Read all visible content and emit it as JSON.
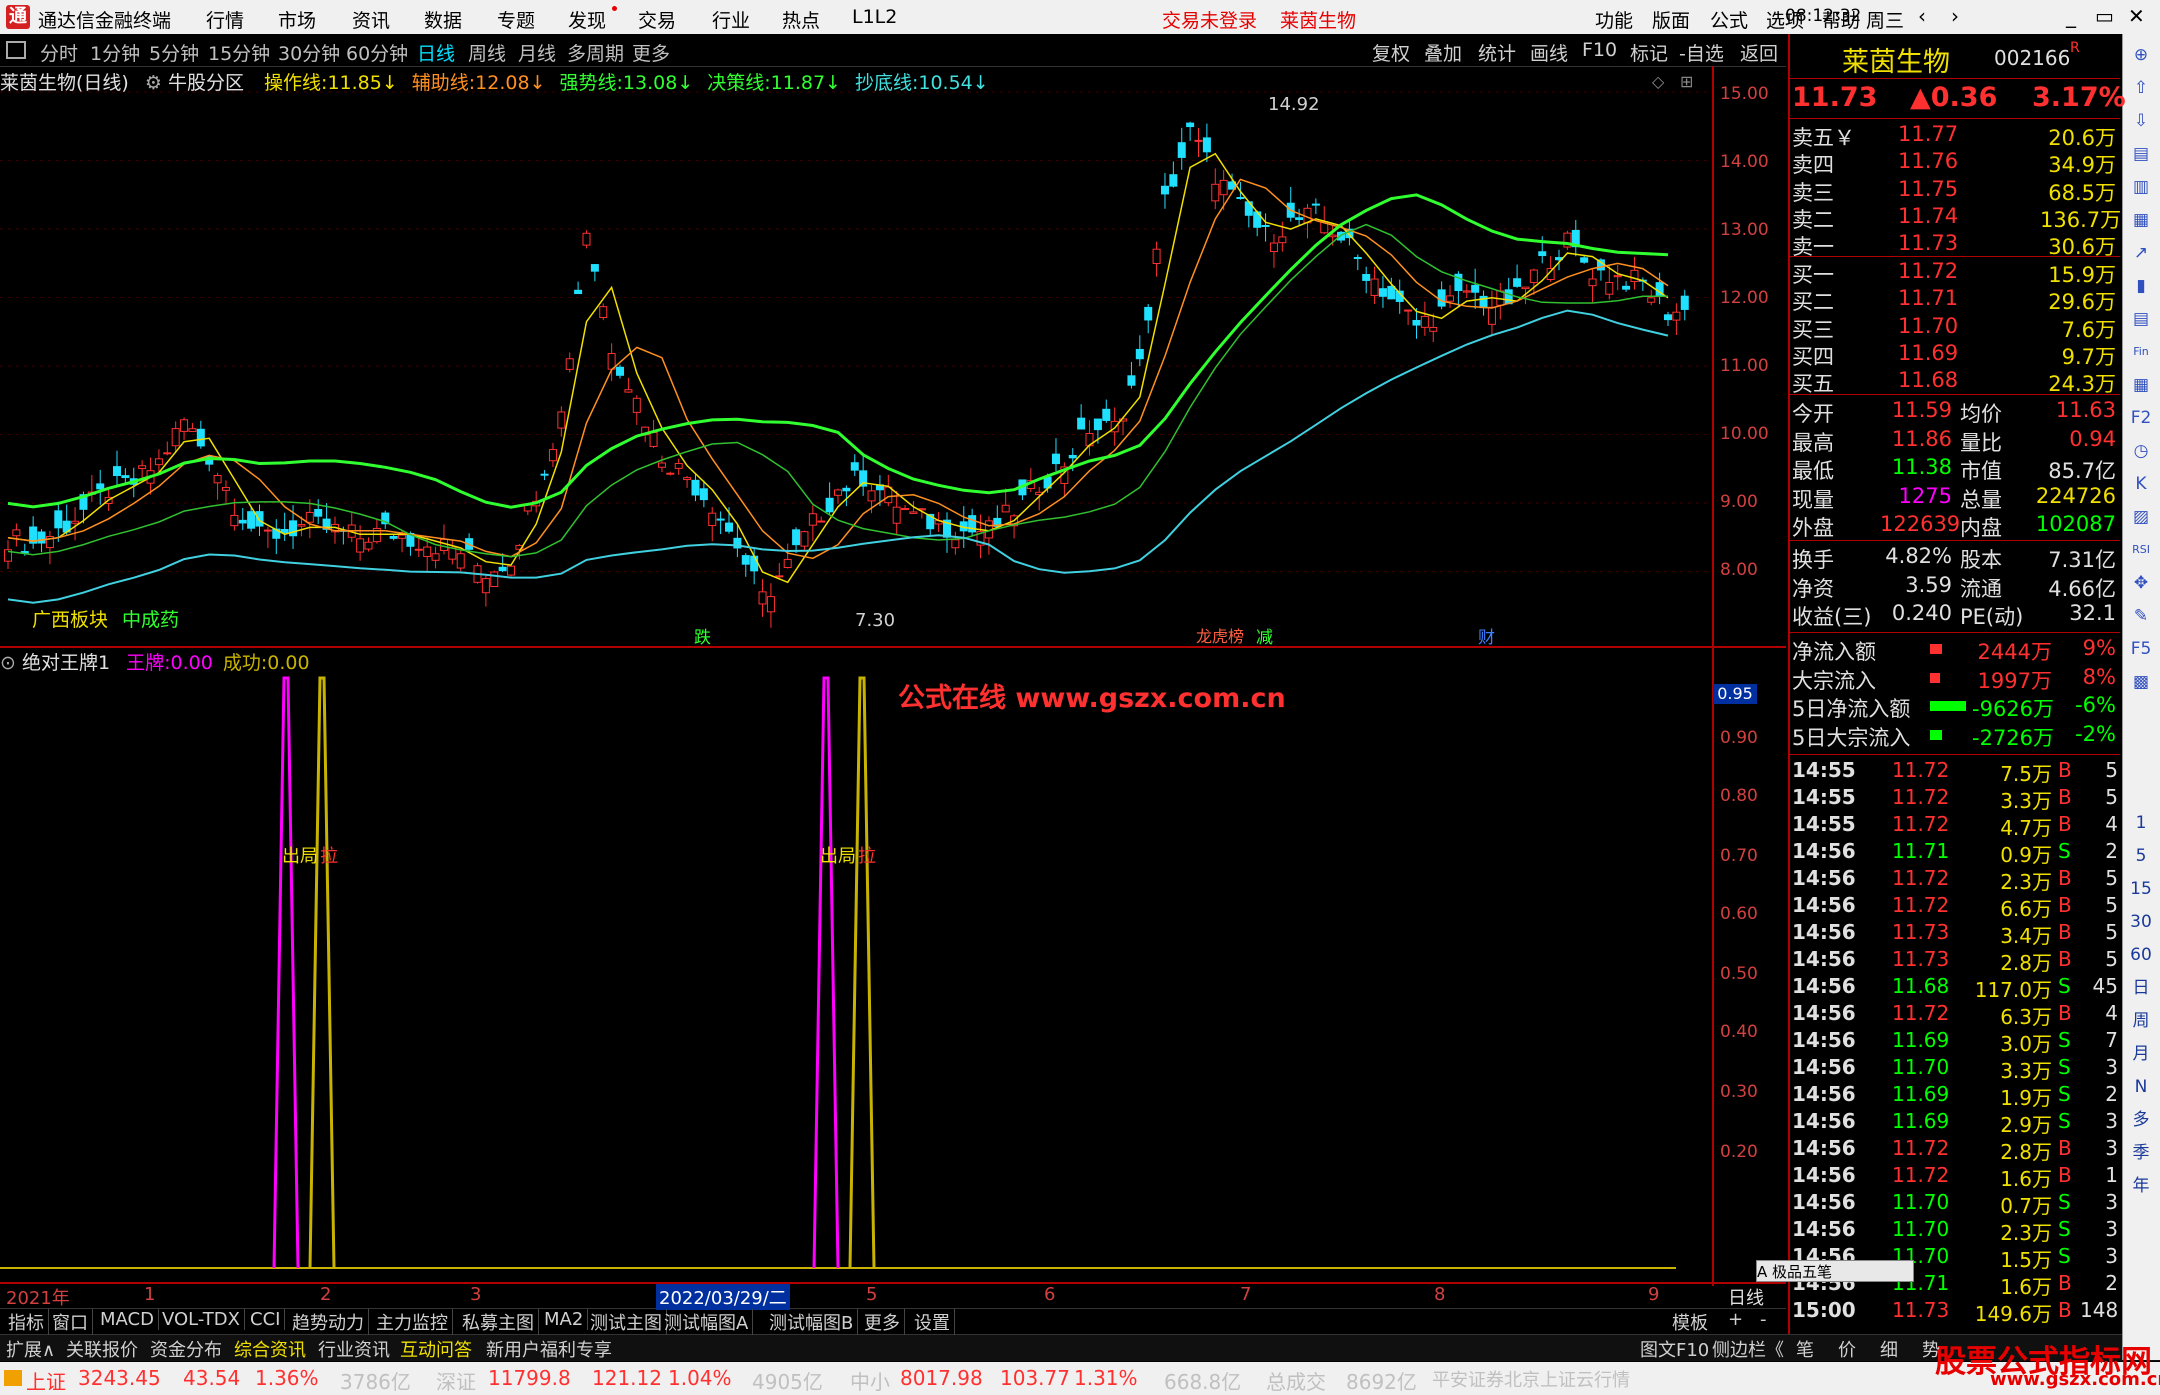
{
  "titlebar": {
    "app_name": "通达信金融终端",
    "menus": [
      "行情",
      "市场",
      "资讯",
      "数据",
      "专题",
      "发现",
      "交易",
      "行业",
      "热点",
      "L1L2"
    ],
    "login_status": "交易未登录",
    "stock_title": "莱茵生物",
    "right_menus": [
      "功能",
      "版面",
      "公式",
      "选项",
      "帮助"
    ],
    "time": "08:12:32",
    "weekday": "周三"
  },
  "periodbar": {
    "items": [
      "分时",
      "1分钟",
      "5分钟",
      "15分钟",
      "30分钟",
      "60分钟",
      "日线",
      "周线",
      "月线",
      "多周期",
      "更多"
    ],
    "active": "日线",
    "right_tools": [
      "复权",
      "叠加",
      "统计",
      "画线",
      "F10",
      "标记",
      "-自选",
      "返回"
    ]
  },
  "main_chart": {
    "stock_label": "莱茵生物(日线)",
    "zone_label": "牛股分区",
    "indicators": [
      {
        "name": "操作线:",
        "value": "11.85",
        "arrow": "↓",
        "color": "#f0e000"
      },
      {
        "name": "辅助线:",
        "value": "12.08",
        "arrow": "↓",
        "color": "#ff9020"
      },
      {
        "name": "强势线:",
        "value": "13.08",
        "arrow": "↓",
        "color": "#30ff30"
      },
      {
        "name": "决策线:",
        "value": "11.87",
        "arrow": "↓",
        "color": "#30ff30"
      },
      {
        "name": "抄底线:",
        "value": "10.54",
        "arrow": "↓",
        "color": "#40e0e0"
      }
    ],
    "high_label": "14.92",
    "low_label": "7.30",
    "sector_tags": [
      "广西板块",
      "中成药"
    ],
    "event_tags": [
      {
        "text": "跌"
      },
      {
        "text": "龙虎榜"
      },
      {
        "text": "减"
      },
      {
        "text": "财"
      }
    ],
    "y_ticks": [
      "15.00",
      "14.00",
      "13.00",
      "12.00",
      "11.00",
      "10.00",
      "9.00",
      "8.00"
    ]
  },
  "sub_chart": {
    "name": "绝对王牌1",
    "series": [
      {
        "name": "王牌:",
        "value": "0.00",
        "color": "#ff00ff"
      },
      {
        "name": "成功:",
        "value": "0.00",
        "color": "#c8b400"
      }
    ],
    "signal_labels": [
      "出局",
      "拉"
    ],
    "watermark": "公式在线  www.gszx.com.cn",
    "current_value": "0.95",
    "y_ticks": [
      "0.90",
      "0.80",
      "0.70",
      "0.60",
      "0.50",
      "0.40",
      "0.30",
      "0.20"
    ]
  },
  "date_axis": {
    "labels": [
      "2021年",
      "1",
      "2",
      "3",
      "2022/03/29/二",
      "5",
      "6",
      "7",
      "8",
      "9"
    ],
    "period": "日线"
  },
  "tabs1": [
    "指标",
    "窗口",
    "MACD",
    "VOL-TDX",
    "CCI",
    "趋势动力",
    "主力监控",
    "私募主图",
    "MA2",
    "测试主图",
    "测试幅图A",
    "测试幅图B",
    "更多",
    "设置"
  ],
  "tabs1_right": [
    "模板",
    "+",
    "-"
  ],
  "tabs2": [
    "扩展∧",
    "关联报价",
    "资金分布",
    "综合资讯",
    "行业资讯",
    "互动问答",
    "新用户福利专享"
  ],
  "tabs2_right": [
    "图文F10",
    "侧边栏《",
    "笔",
    "价",
    "细",
    "势"
  ],
  "status": {
    "sh_name": "上证",
    "sh_value": "3243.45",
    "sh_change": "43.54",
    "sh_pct": "1.36%",
    "sh_amount": "3786亿",
    "sz_name": "深证",
    "sz_value": "11799.8",
    "sz_change": "121.12",
    "sz_pct": "1.04%",
    "sz_amount": "4905亿",
    "zx_name": "中小",
    "zx_value": "8017.98",
    "zx_change": "103.77",
    "zx_pct": "1.31%",
    "zx_amount": "668.8亿",
    "total_label": "总成交",
    "total_value": "8692亿",
    "broker": "平安证券北京上证云行情"
  },
  "quote": {
    "name": "莱茵生物",
    "code": "002166",
    "r_mark": "R",
    "price": "11.73",
    "change": "▲0.36",
    "pct": "3.17%",
    "sells": [
      {
        "label": "卖五￥",
        "price": "11.77",
        "vol": "20.6万"
      },
      {
        "label": "卖四",
        "price": "11.76",
        "vol": "34.9万"
      },
      {
        "label": "卖三",
        "price": "11.75",
        "vol": "68.5万"
      },
      {
        "label": "卖二",
        "price": "11.74",
        "vol": "136.7万"
      },
      {
        "label": "卖一",
        "price": "11.73",
        "vol": "30.6万"
      }
    ],
    "buys": [
      {
        "label": "买一",
        "price": "11.72",
        "vol": "15.9万"
      },
      {
        "label": "买二",
        "price": "11.71",
        "vol": "29.6万"
      },
      {
        "label": "买三",
        "price": "11.70",
        "vol": "7.6万"
      },
      {
        "label": "买四",
        "price": "11.69",
        "vol": "9.7万"
      },
      {
        "label": "买五",
        "price": "11.68",
        "vol": "24.3万"
      }
    ],
    "stats": [
      {
        "l1": "今开",
        "v1": "11.59",
        "l2": "均价",
        "v2": "11.63"
      },
      {
        "l1": "最高",
        "v1": "11.86",
        "l2": "量比",
        "v2": "0.94"
      },
      {
        "l1": "最低",
        "v1": "11.38",
        "l2": "市值",
        "v2": "85.7亿"
      },
      {
        "l1": "现量",
        "v1": "1275",
        "l2": "总量",
        "v2": "224726"
      },
      {
        "l1": "外盘",
        "v1": "122639",
        "l2": "内盘",
        "v2": "102087"
      }
    ],
    "fundamentals": [
      {
        "l1": "换手",
        "v1": "4.82%",
        "l2": "股本",
        "v2": "7.31亿"
      },
      {
        "l1": "净资",
        "v1": "3.59",
        "l2": "流通",
        "v2": "4.66亿"
      },
      {
        "l1": "收益(三)",
        "v1": "0.240",
        "l2": "PE(动)",
        "v2": "32.1"
      }
    ],
    "flows": [
      {
        "label": "净流入额",
        "value": "2444万",
        "pct": "9%",
        "dir": "up",
        "bar": 0.3
      },
      {
        "label": "大宗流入",
        "value": "1997万",
        "pct": "8%",
        "dir": "up",
        "bar": 0.25
      },
      {
        "label": "5日净流入额",
        "value": "-9626万",
        "pct": "-6%",
        "dir": "down",
        "bar": 0.9
      },
      {
        "label": "5日大宗流入",
        "value": "-2726万",
        "pct": "-2%",
        "dir": "down",
        "bar": 0.3
      }
    ],
    "ticks": [
      {
        "t": "14:55",
        "p": "11.72",
        "v": "7.5万",
        "bs": "B",
        "n": "5"
      },
      {
        "t": "14:55",
        "p": "11.72",
        "v": "3.3万",
        "bs": "B",
        "n": "5"
      },
      {
        "t": "14:55",
        "p": "11.72",
        "v": "4.7万",
        "bs": "B",
        "n": "4"
      },
      {
        "t": "14:56",
        "p": "11.71",
        "v": "0.9万",
        "bs": "S",
        "n": "2"
      },
      {
        "t": "14:56",
        "p": "11.72",
        "v": "2.3万",
        "bs": "B",
        "n": "5"
      },
      {
        "t": "14:56",
        "p": "11.72",
        "v": "6.6万",
        "bs": "B",
        "n": "5"
      },
      {
        "t": "14:56",
        "p": "11.73",
        "v": "3.4万",
        "bs": "B",
        "n": "5"
      },
      {
        "t": "14:56",
        "p": "11.73",
        "v": "2.8万",
        "bs": "B",
        "n": "5"
      },
      {
        "t": "14:56",
        "p": "11.68",
        "v": "117.0万",
        "bs": "S",
        "n": "45"
      },
      {
        "t": "14:56",
        "p": "11.72",
        "v": "6.3万",
        "bs": "B",
        "n": "4"
      },
      {
        "t": "14:56",
        "p": "11.69",
        "v": "3.0万",
        "bs": "S",
        "n": "7"
      },
      {
        "t": "14:56",
        "p": "11.70",
        "v": "3.3万",
        "bs": "S",
        "n": "3"
      },
      {
        "t": "14:56",
        "p": "11.69",
        "v": "1.9万",
        "bs": "S",
        "n": "2"
      },
      {
        "t": "14:56",
        "p": "11.69",
        "v": "2.9万",
        "bs": "S",
        "n": "3"
      },
      {
        "t": "14:56",
        "p": "11.72",
        "v": "2.8万",
        "bs": "B",
        "n": "3"
      },
      {
        "t": "14:56",
        "p": "11.72",
        "v": "1.6万",
        "bs": "B",
        "n": "1"
      },
      {
        "t": "14:56",
        "p": "11.70",
        "v": "0.7万",
        "bs": "S",
        "n": "3"
      },
      {
        "t": "14:56",
        "p": "11.70",
        "v": "2.3万",
        "bs": "S",
        "n": "3"
      },
      {
        "t": "14:56",
        "p": "11.70",
        "v": "1.5万",
        "bs": "S",
        "n": "3"
      },
      {
        "t": "14:56",
        "p": "11.71",
        "v": "1.6万",
        "bs": "B",
        "n": "2"
      },
      {
        "t": "15:00",
        "p": "11.73",
        "v": "149.6万",
        "bs": "B",
        "n": "148"
      }
    ],
    "ime_label": "A 极品五笔"
  },
  "side_icons": [
    "cross-icon",
    "up-arrow-icon",
    "down-arrow-icon",
    "chart-icon",
    "book-icon",
    "list-icon",
    "trend-icon",
    "candle-icon",
    "table-icon",
    "fund-icon",
    "bar-icon",
    "f2-icon",
    "clock-icon",
    "k-icon",
    "rsi-icon",
    "move-icon",
    "pen-icon",
    "f5-icon",
    "green-icon",
    "arrow-icon"
  ],
  "side_labels": [
    "1",
    "5",
    "15",
    "30",
    "60",
    "日",
    "周",
    "月",
    "N",
    "多",
    "季",
    "年"
  ],
  "brand": {
    "name": "股票公式指标网",
    "url": "www.gszx.com.cn"
  }
}
